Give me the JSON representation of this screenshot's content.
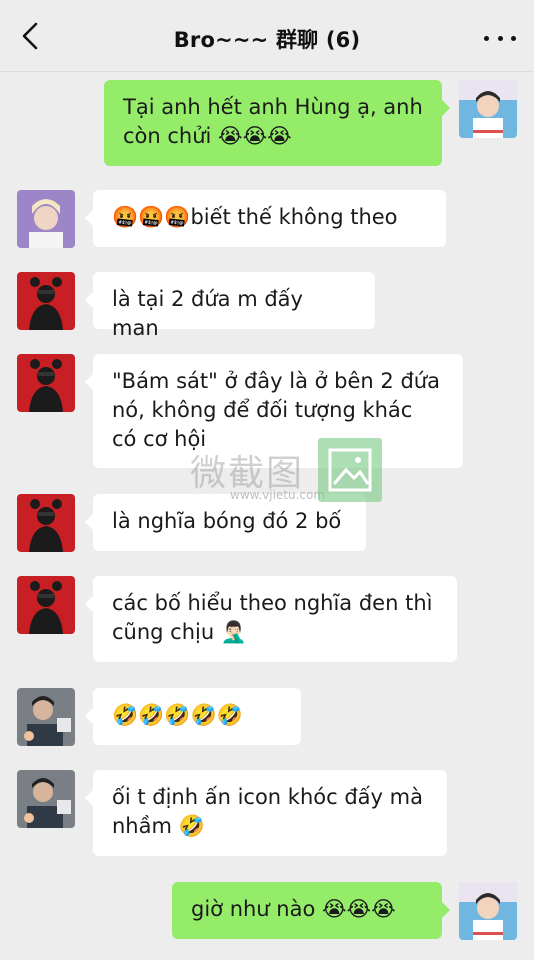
{
  "header": {
    "title": "Bro~~~ 群聊 (6)",
    "back_icon": "chevron-left-icon",
    "more_icon": "more-dots-icon"
  },
  "messages": [
    {
      "side": "right",
      "sender": "me",
      "text": "Tại anh hết anh Hùng ạ, anh\ncòn chửi 😭😭😭"
    },
    {
      "side": "left",
      "sender": "blonde",
      "text": "🤬🤬🤬biết thế không theo"
    },
    {
      "side": "left",
      "sender": "red",
      "text": "là tại 2 đứa m đấy man"
    },
    {
      "side": "left",
      "sender": "red",
      "text": "\"Bám sát\" ở đây là ở bên 2 đứa\nnó, không để đối tượng khác\ncó cơ hội"
    },
    {
      "side": "left",
      "sender": "red",
      "text": "là nghĩa bóng đó 2 bố"
    },
    {
      "side": "left",
      "sender": "red",
      "text": "các bố hiểu theo nghĩa đen thì\ncũng chịu 🤦🏻‍♂️"
    },
    {
      "side": "left",
      "sender": "gray",
      "text": "🤣🤣🤣🤣🤣"
    },
    {
      "side": "left",
      "sender": "gray",
      "text": "ối t định ấn icon khóc đấy mà\nnhầm 🤣"
    },
    {
      "side": "right",
      "sender": "me",
      "text": "giờ như nào 😭😭😭"
    }
  ],
  "watermark": {
    "text": "微截图",
    "url": "www.vjietu.com"
  },
  "colors": {
    "background": "#ededed",
    "bubble_self": "#95ec69",
    "bubble_other": "#ffffff"
  }
}
